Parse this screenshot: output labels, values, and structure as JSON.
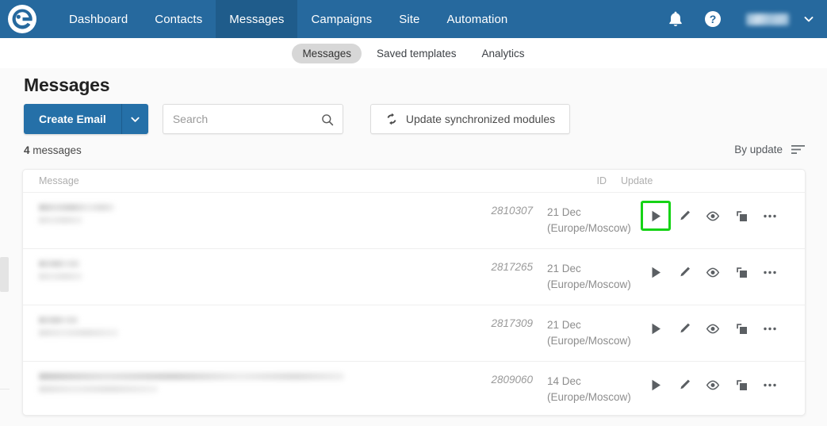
{
  "header": {
    "logo_icon": "esputnik-logo-icon",
    "brand_color": "#26699e",
    "active_color": "#1f5c8b",
    "nav": [
      {
        "label": "Dashboard",
        "active": false
      },
      {
        "label": "Contacts",
        "active": false
      },
      {
        "label": "Messages",
        "active": true
      },
      {
        "label": "Campaigns",
        "active": false
      },
      {
        "label": "Site",
        "active": false
      },
      {
        "label": "Automation",
        "active": false
      }
    ],
    "notifications_icon": "bell-icon",
    "help_icon": "question-mark-icon",
    "account_name": "",
    "account_caret_icon": "chevron-down-icon"
  },
  "subtabs": [
    {
      "label": "Messages",
      "active": true
    },
    {
      "label": "Saved templates",
      "active": false
    },
    {
      "label": "Analytics",
      "active": false
    }
  ],
  "page": {
    "title": "Messages"
  },
  "toolbar": {
    "create_label": "Create Email",
    "create_caret_icon": "chevron-down-icon",
    "create_color": "#2570a8",
    "search": {
      "value": "",
      "placeholder": "Search",
      "icon": "search-icon"
    },
    "update_modules": {
      "label": "Update synchronized modules",
      "icon": "sync-refresh-icon"
    }
  },
  "list_meta": {
    "count": "4",
    "count_suffix": " messages",
    "sort_label": "By update",
    "sort_icon": "sort-descending-icon"
  },
  "table": {
    "columns": {
      "message": "Message",
      "id": "ID",
      "update": "Update"
    },
    "rows": [
      {
        "name": "",
        "name_redacted": true,
        "id": "2810307",
        "update_date": "21 Dec",
        "update_tz": "(Europe/Moscow)",
        "blur_widths": [
          "95px",
          "55px"
        ],
        "actions": [
          {
            "icon": "play-icon",
            "name": "send-button",
            "highlighted": true
          },
          {
            "icon": "pencil-icon",
            "name": "edit-button",
            "highlighted": false
          },
          {
            "icon": "eye-icon",
            "name": "preview-button",
            "highlighted": false
          },
          {
            "icon": "copy-icon",
            "name": "duplicate-button",
            "highlighted": false
          },
          {
            "icon": "ellipsis-icon",
            "name": "more-actions-button",
            "highlighted": false
          }
        ]
      },
      {
        "name": "",
        "name_redacted": true,
        "id": "2817265",
        "update_date": "21 Dec",
        "update_tz": "(Europe/Moscow)",
        "blur_widths": [
          "52px",
          "55px"
        ],
        "actions": [
          {
            "icon": "play-icon",
            "name": "send-button",
            "highlighted": false
          },
          {
            "icon": "pencil-icon",
            "name": "edit-button",
            "highlighted": false
          },
          {
            "icon": "eye-icon",
            "name": "preview-button",
            "highlighted": false
          },
          {
            "icon": "copy-icon",
            "name": "duplicate-button",
            "highlighted": false
          },
          {
            "icon": "ellipsis-icon",
            "name": "more-actions-button",
            "highlighted": false
          }
        ]
      },
      {
        "name": "",
        "name_redacted": true,
        "id": "2817309",
        "update_date": "21 Dec",
        "update_tz": "(Europe/Moscow)",
        "blur_widths": [
          "50px",
          "100px"
        ],
        "actions": [
          {
            "icon": "play-icon",
            "name": "send-button",
            "highlighted": false
          },
          {
            "icon": "pencil-icon",
            "name": "edit-button",
            "highlighted": false
          },
          {
            "icon": "eye-icon",
            "name": "preview-button",
            "highlighted": false
          },
          {
            "icon": "copy-icon",
            "name": "duplicate-button",
            "highlighted": false
          },
          {
            "icon": "ellipsis-icon",
            "name": "more-actions-button",
            "highlighted": false
          }
        ]
      },
      {
        "name": "",
        "name_redacted": true,
        "id": "2809060",
        "update_date": "14 Dec",
        "update_tz": "(Europe/Moscow)",
        "blur_widths": [
          "385px",
          "150px"
        ],
        "actions": [
          {
            "icon": "play-icon",
            "name": "send-button",
            "highlighted": false
          },
          {
            "icon": "pencil-icon",
            "name": "edit-button",
            "highlighted": false
          },
          {
            "icon": "eye-icon",
            "name": "preview-button",
            "highlighted": false
          },
          {
            "icon": "copy-icon",
            "name": "duplicate-button",
            "highlighted": false
          },
          {
            "icon": "ellipsis-icon",
            "name": "more-actions-button",
            "highlighted": false
          }
        ]
      }
    ]
  },
  "annotation": {
    "highlight_color": "#16d316",
    "target": "send-button-row-1"
  }
}
